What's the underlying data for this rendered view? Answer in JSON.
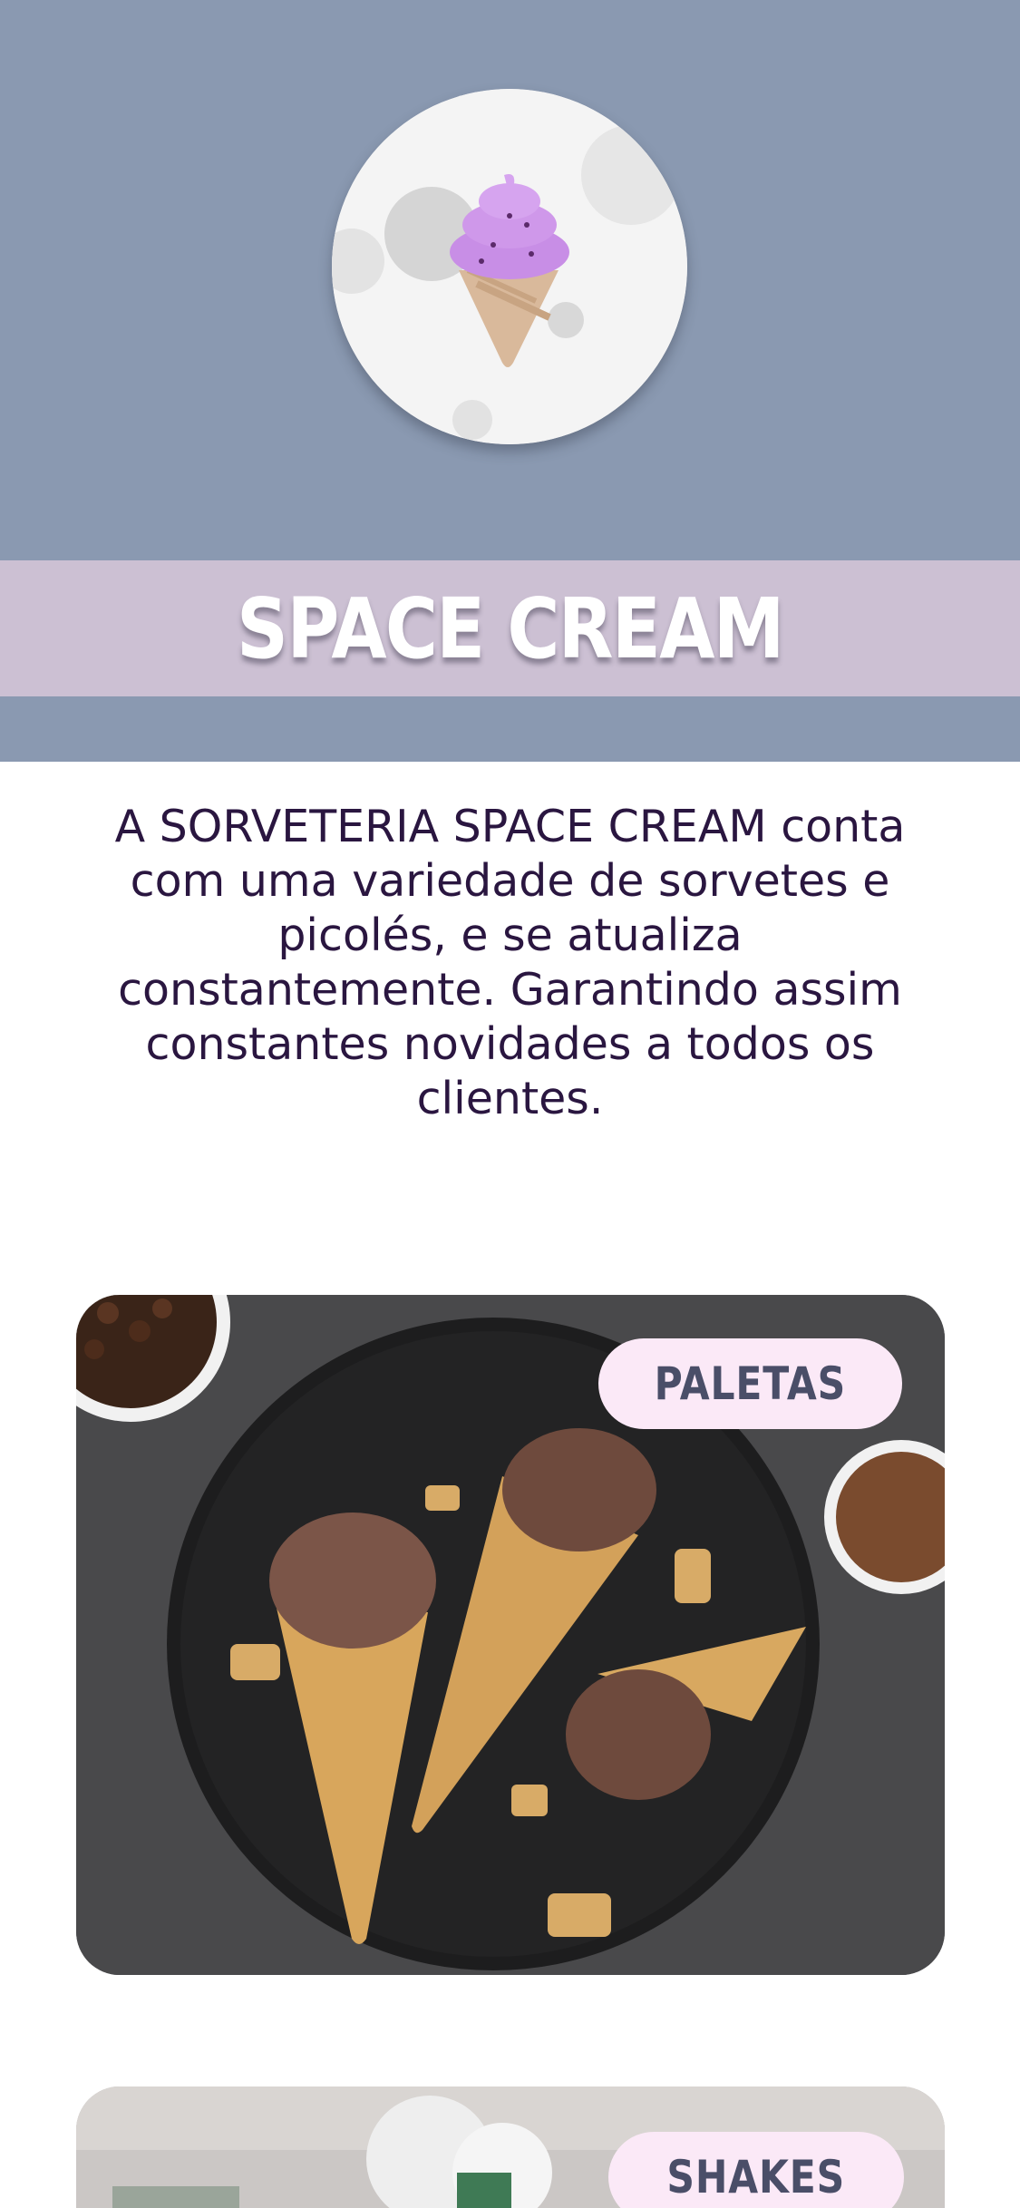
{
  "header": {
    "logo_icon": "ice-cream-moon-icon",
    "title": "SPACE CREAM",
    "bg_color": "#8a99b1",
    "band_color": "#ccc0d3"
  },
  "intro": {
    "text": "A SORVETERIA SPACE CREAM conta com uma variedade de sorvetes e picolés, e se atualiza constantemente. Garantindo assim constantes novidades a todos os clientes."
  },
  "cards": [
    {
      "label": "PALETAS",
      "image": "chocolate-ice-cream-cones-photo"
    },
    {
      "label": "SHAKES",
      "image": "shakes-photo"
    }
  ]
}
